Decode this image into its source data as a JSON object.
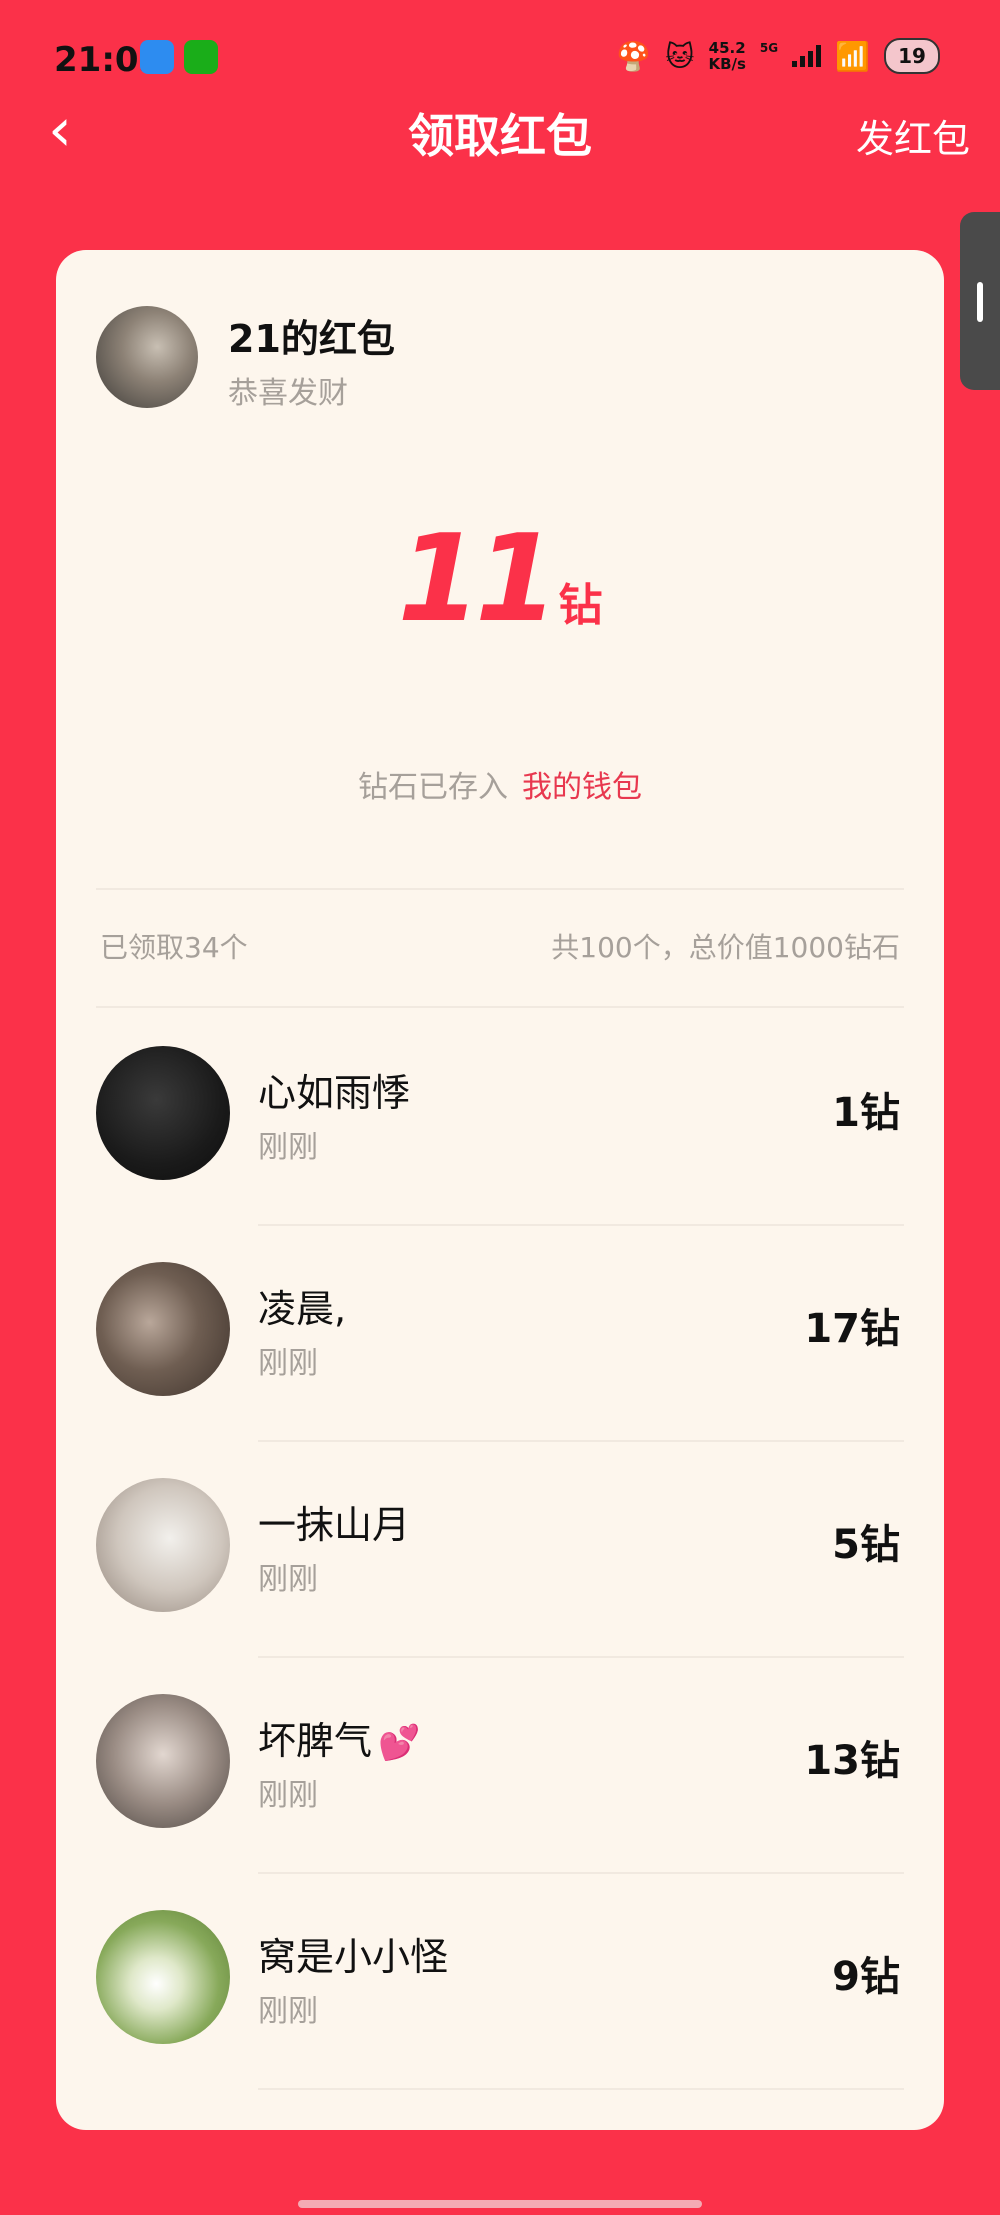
{
  "status_bar": {
    "time": "21:03",
    "net_speed_value": "45.2",
    "net_speed_unit": "KB/s",
    "network_type": "5G",
    "battery": "19"
  },
  "nav": {
    "back_icon": "chevron-left-icon",
    "title": "领取红包",
    "action_label": "发红包"
  },
  "packet": {
    "sender_name": "21的红包",
    "greeting": "恭喜发财",
    "amount": "11",
    "amount_unit": "钻",
    "wallet_label": "钻石已存入",
    "wallet_link": "我的钱包"
  },
  "summary": {
    "claimed": "已领取34个",
    "total": "共100个，总价值1000钻石"
  },
  "claims": [
    {
      "name": "心如雨悸",
      "time": "刚刚",
      "amount": "1钻"
    },
    {
      "name": "凌晨,",
      "time": "刚刚",
      "amount": "17钻"
    },
    {
      "name": "一抹山月",
      "time": "刚刚",
      "amount": "5钻"
    },
    {
      "name": "坏脾气",
      "emoji": "💕",
      "time": "刚刚",
      "amount": "13钻"
    },
    {
      "name": "窝是小小怪",
      "time": "刚刚",
      "amount": "9钻"
    }
  ],
  "colors": {
    "brand_red": "#fb3149",
    "card_bg": "#fdf6ed",
    "link_red": "#e8384f",
    "muted_text": "#a6a09a"
  }
}
